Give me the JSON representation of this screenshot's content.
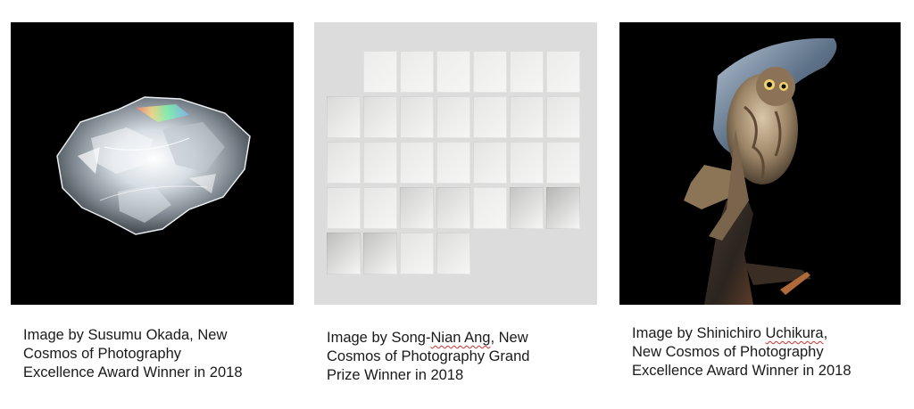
{
  "images": [
    {
      "subject": "ice crystal on black background",
      "caption": {
        "lines": [
          "Image by Susumu Okada, New",
          "Cosmos of Photography",
          "Excellence Award Winner in 2018"
        ]
      }
    },
    {
      "subject": "grid of grey and white square panels",
      "caption": {
        "line1_prefix": "Image by Song-",
        "line1_marked": "Nian Ang",
        "line1_suffix": ", New",
        "line2": "Cosmos of Photography Grand",
        "line3": "Prize Winner in 2018"
      }
    },
    {
      "subject": "owl perched on a branch on black background",
      "caption": {
        "line1_prefix": "Image by Shinichiro ",
        "line1_marked": "Uchikura",
        "line1_suffix": ",",
        "line2": "New Cosmos of Photography",
        "line3": "Excellence Award Winner in 2018"
      }
    }
  ],
  "colors": {
    "spellcheck_underline": "#d0302a",
    "photo_background_dark": "#000000",
    "grid_background": "#dcdcdc"
  }
}
